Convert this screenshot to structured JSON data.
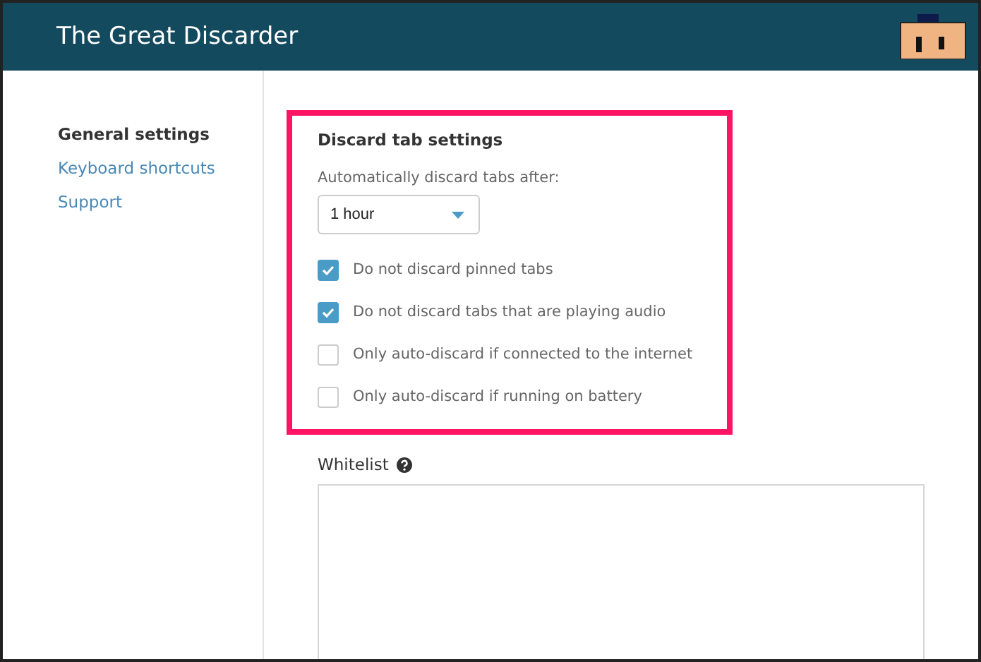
{
  "header": {
    "title": "The Great Discarder"
  },
  "sidebar": {
    "items": [
      {
        "label": "General settings",
        "selected": true
      },
      {
        "label": "Keyboard shortcuts",
        "selected": false
      },
      {
        "label": "Support",
        "selected": false
      }
    ]
  },
  "discard_settings": {
    "title": "Discard tab settings",
    "highlighted": true,
    "timeout_label": "Automatically discard tabs after:",
    "timeout_value": "1 hour",
    "options": [
      {
        "label": "Do not discard pinned tabs",
        "checked": true
      },
      {
        "label": "Do not discard tabs that are playing audio",
        "checked": true
      },
      {
        "label": "Only auto-discard if connected to the internet",
        "checked": false
      },
      {
        "label": "Only auto-discard if running on battery",
        "checked": false
      }
    ]
  },
  "whitelist": {
    "label": "Whitelist"
  }
}
